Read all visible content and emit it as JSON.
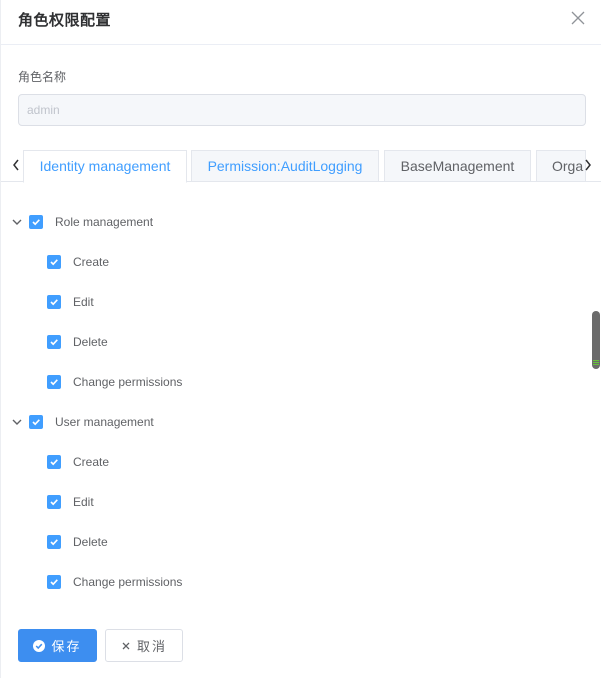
{
  "dialog": {
    "title": "角色权限配置",
    "close_icon": "close-icon"
  },
  "form": {
    "role_name_label": "角色名称",
    "role_name_value": "admin"
  },
  "tabs": [
    {
      "label": "Identity management",
      "active": true
    },
    {
      "label": "Permission:AuditLogging",
      "active": false
    },
    {
      "label": "BaseManagement",
      "active": false
    },
    {
      "label": "Orga",
      "active": false
    }
  ],
  "tree": [
    {
      "label": "Role management",
      "checked": true,
      "expanded": true,
      "children": [
        {
          "label": "Create",
          "checked": true
        },
        {
          "label": "Edit",
          "checked": true
        },
        {
          "label": "Delete",
          "checked": true
        },
        {
          "label": "Change permissions",
          "checked": true
        }
      ]
    },
    {
      "label": "User management",
      "checked": true,
      "expanded": true,
      "children": [
        {
          "label": "Create",
          "checked": true
        },
        {
          "label": "Edit",
          "checked": true
        },
        {
          "label": "Delete",
          "checked": true
        },
        {
          "label": "Change permissions",
          "checked": true
        }
      ]
    }
  ],
  "footer": {
    "save_label": "保存",
    "cancel_label": "取消"
  },
  "colors": {
    "accent": "#409eff",
    "save_button": "#3d8ef0"
  }
}
